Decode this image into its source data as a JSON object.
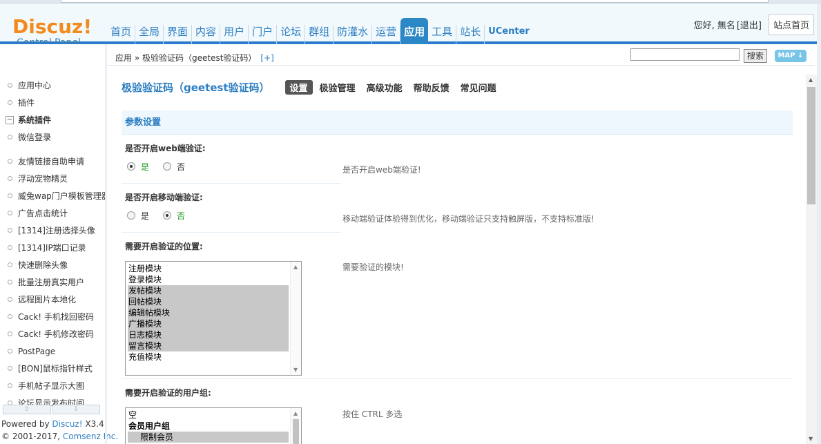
{
  "logo": {
    "main": "Discuz!",
    "sub": "Control Panel"
  },
  "nav": [
    "首页",
    "全局",
    "界面",
    "内容",
    "用户",
    "门户",
    "论坛",
    "群组",
    "防灌水",
    "运营",
    "应用",
    "工具",
    "站长",
    "UCenter"
  ],
  "nav_active_index": 10,
  "user": {
    "greeting": "您好, 無名",
    "logout": "[退出]",
    "site_home": "站点首页"
  },
  "breadcrumb": {
    "text": "应用 » 极验验证码（geetest验证码）",
    "plus": "[+]"
  },
  "search": {
    "button": "搜索",
    "map": "MAP ↓"
  },
  "sidebar": {
    "top_items": [
      "应用中心",
      "插件"
    ],
    "group_label": "系统插件",
    "group_symbol": "−",
    "group_items": [
      "微信登录"
    ],
    "plugin_items": [
      "友情链接自助申请",
      "浮动宠物精灵",
      "威兔wap门户模板管理器",
      "广告点击统计",
      "[1314]注册选择头像",
      "[1314]IP端口记录",
      "快速删除头像",
      "批量注册真实用户",
      "远程图片本地化",
      "Cack! 手机找回密码",
      "Cack! 手机修改密码",
      "PostPage",
      "[BON]鼠标指针样式",
      "手机帖子显示大图",
      "论坛显示发布时间"
    ],
    "arrow_up": "⇧",
    "arrow_down": "⇩",
    "powered_prefix": "Powered by",
    "powered_link": "Discuz!",
    "powered_ver": "X3.4",
    "copyright": "© 2001-2017,",
    "copyright_link": "Comsenz Inc."
  },
  "main": {
    "title": "极验验证码（geetest验证码）",
    "tabs": [
      "设置",
      "极验管理",
      "高级功能",
      "帮助反馈",
      "常见问题"
    ],
    "section": "参数设置",
    "web_verify": {
      "label": "是否开启web端验证:",
      "yes": "是",
      "no": "否",
      "selected": "yes",
      "tip": "是否开启web端验证!"
    },
    "mobile_verify": {
      "label": "是否开启移动端验证:",
      "yes": "是",
      "no": "否",
      "selected": "no",
      "tip": "移动端验证体验得到优化，移动端验证只支持触屏版，不支持标准版!"
    },
    "positions": {
      "label": "需要开启验证的位置:",
      "options": [
        "注册模块",
        "登录模块",
        "发帖模块",
        "回帖模块",
        "编辑帖模块",
        "广播模块",
        "日志模块",
        "留言模块",
        "充值模块"
      ],
      "selected": [
        false,
        false,
        true,
        true,
        true,
        true,
        true,
        true,
        false
      ],
      "tip": "需要验证的模块!"
    },
    "usergroups": {
      "label": "需要开启验证的用户组:",
      "options": [
        "空",
        "会员用户组",
        "限制会员"
      ],
      "tip": "按住 CTRL 多选"
    }
  },
  "colors": {
    "accent": "#2c7ec2",
    "nav_active": "#2b87c6",
    "logo": "#f28a1c",
    "header_bg": "#f2f9fd",
    "section_bg": "#eef7fd"
  }
}
